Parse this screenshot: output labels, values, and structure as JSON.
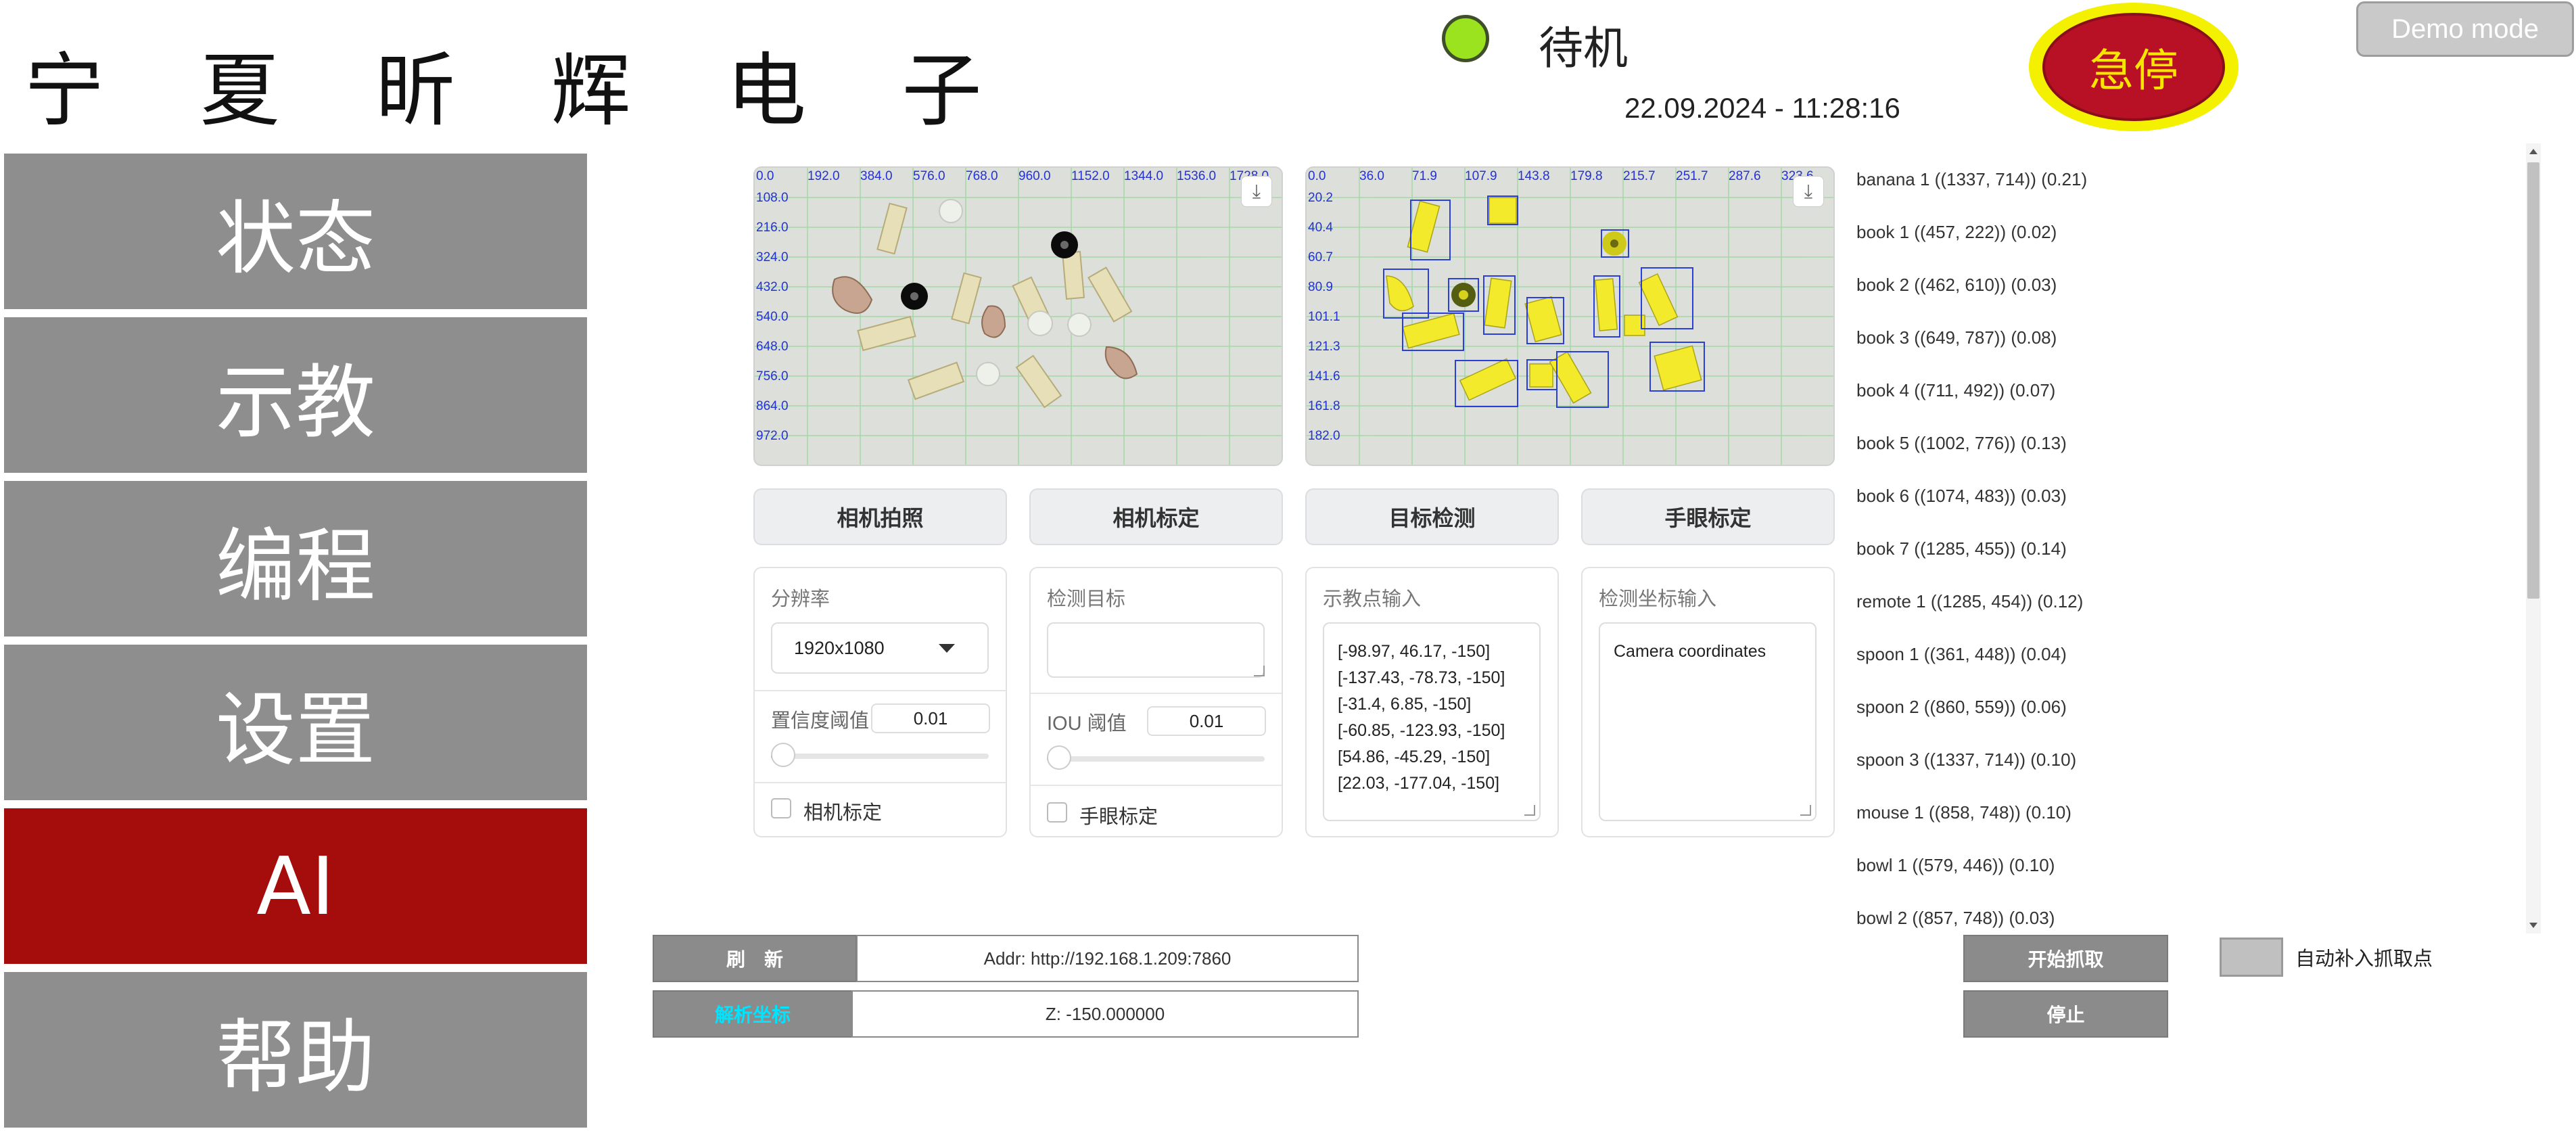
{
  "header": {
    "brand": "宁 夏 昕 辉 电 子",
    "status": "待机",
    "datetime": "22.09.2024 - 11:28:16",
    "estop_label": "急停",
    "demo_label": "Demo mode",
    "colors": {
      "status_led": "#9be31f",
      "estop": "#b81125",
      "estop_ring": "#f3f000"
    }
  },
  "sidebar": {
    "items": [
      {
        "label": "状态"
      },
      {
        "label": "示教"
      },
      {
        "label": "编程"
      },
      {
        "label": "设置"
      },
      {
        "label": "AI",
        "active": true
      },
      {
        "label": "帮助"
      }
    ],
    "colors": {
      "normal": "#8e8e8e",
      "active": "#a50d0d"
    }
  },
  "camera_raw": {
    "x_ticks": [
      "0.0",
      "192.0",
      "384.0",
      "576.0",
      "768.0",
      "960.0",
      "1152.0",
      "1344.0",
      "1536.0",
      "1728.0"
    ],
    "y_ticks": [
      "108.0",
      "216.0",
      "324.0",
      "432.0",
      "540.0",
      "648.0",
      "756.0",
      "864.0",
      "972.0"
    ],
    "download_icon": "download-icon"
  },
  "camera_detect": {
    "x_ticks": [
      "0.0",
      "36.0",
      "71.9",
      "107.9",
      "143.8",
      "179.8",
      "215.7",
      "251.7",
      "287.6",
      "323.6"
    ],
    "y_ticks": [
      "20.2",
      "40.4",
      "60.7",
      "80.9",
      "101.1",
      "121.3",
      "141.6",
      "161.8",
      "182.0"
    ],
    "download_icon": "download-icon"
  },
  "actions": [
    "相机拍照",
    "相机标定",
    "目标检测",
    "手眼标定"
  ],
  "panel1": {
    "resolution_label": "分辨率",
    "resolution_value": "1920x1080",
    "confidence_label": "置信度阈值",
    "confidence_value": "0.01",
    "checkbox_label": "相机标定"
  },
  "panel2": {
    "target_label": "检测目标",
    "target_value": "",
    "iou_label": "IOU 阈值",
    "iou_value": "0.01",
    "checkbox_label": "手眼标定"
  },
  "panel3": {
    "label": "示教点输入",
    "lines": [
      "[-98.97, 46.17, -150]",
      "[-137.43, -78.73, -150]",
      "[-31.4, 6.85, -150]",
      "[-60.85, -123.93, -150]",
      "[54.86, -45.29, -150]",
      "[22.03, -177.04, -150]"
    ]
  },
  "panel4": {
    "label": "检测坐标输入",
    "value": "Camera coordinates"
  },
  "detections": [
    "banana 1 ((1337, 714)) (0.21)",
    "book 1 ((457, 222)) (0.02)",
    "book 2 ((462, 610)) (0.03)",
    "book 3 ((649, 787)) (0.08)",
    "book 4 ((711, 492)) (0.07)",
    "book 5 ((1002, 776)) (0.13)",
    "book 6 ((1074, 483)) (0.03)",
    "book 7 ((1285, 455)) (0.14)",
    "remote 1 ((1285, 454)) (0.12)",
    "spoon 1 ((361, 448)) (0.04)",
    "spoon 2 ((860, 559)) (0.06)",
    "spoon 3 ((1337, 714)) (0.10)",
    "mouse 1 ((858, 748)) (0.10)",
    "bowl 1 ((579, 446)) (0.10)",
    "bowl 2 ((857, 748)) (0.03)"
  ],
  "bottom": {
    "refresh_label": "刷　新",
    "addr_value": "Addr: http://192.168.1.209:7860",
    "parse_label": "解析坐标",
    "parse_color": "#00e5ff",
    "z_value": "Z: -150.000000",
    "start_label": "开始抓取",
    "stop_label": "停止",
    "auto_label": "自动补入抓取点"
  }
}
